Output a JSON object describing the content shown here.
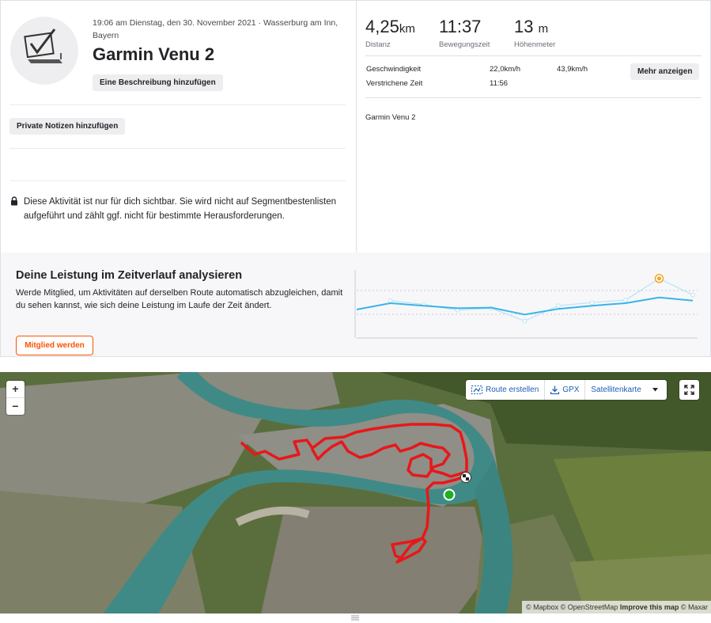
{
  "header": {
    "meta": "19:06 am Dienstag, den 30. November 2021 · Wasserburg am Inn, Bayern",
    "title": "Garmin Venu 2",
    "description_button": "Eine Beschreibung hinzufügen",
    "notes_button": "Private Notizen hinzufügen",
    "privacy_text": "Diese Aktivität ist nur für dich sichtbar. Sie wird nicht auf Segmentbestenlisten aufgeführt und zählt ggf. nicht für bestimmte Herausforderungen."
  },
  "stats": [
    {
      "value": "4,25",
      "unit": "km",
      "label": "Distanz"
    },
    {
      "value": "11:37",
      "unit": "",
      "label": "Bewegungszeit"
    },
    {
      "value": "13",
      "unit": "m",
      "label": "Höhenmeter"
    }
  ],
  "details": {
    "speed_label": "Geschwindigkeit",
    "speed_avg": "22,0km/h",
    "speed_max": "43,9km/h",
    "elapsed_label": "Verstrichene Zeit",
    "elapsed_value": "11:56",
    "more_button": "Mehr anzeigen",
    "device": "Garmin Venu 2"
  },
  "upsell": {
    "title": "Deine Leistung im Zeitverlauf analysieren",
    "text": "Werde Mitglied, um Aktivitäten auf derselben Route automatisch abzugleichen, damit du sehen kannst, wie sich deine Leistung im Laufe der Zeit ändert.",
    "button": "Mitglied werden"
  },
  "chart_data": {
    "type": "line",
    "title": "",
    "xlabel": "",
    "ylabel": "",
    "series": [
      {
        "values": [
          4,
          5,
          4.6,
          4.2,
          4.3,
          3.2,
          4.1,
          4.6,
          5,
          5.9,
          5.4
        ]
      },
      {
        "values": [
          null,
          5.4,
          4.8,
          3.9,
          4.2,
          2.2,
          4.6,
          5.1,
          5.5,
          8.9,
          6.3
        ]
      }
    ],
    "highlight_index": 9,
    "ylim": [
      0,
      10
    ],
    "colors": {
      "line": "#3ab4e6",
      "marker": "#b9e3f4",
      "highlight": "#f4a623",
      "grid": "#c9c9d4"
    }
  },
  "map": {
    "zoom_in": "+",
    "zoom_out": "−",
    "route_button": "Route erstellen",
    "gpx_button": "GPX",
    "layer_button": "Satellitenkarte",
    "attribution_mapbox": "© Mapbox",
    "attribution_osm": "© OpenStreetMap",
    "attribution_improve": "Improve this map",
    "attribution_maxar": "© Maxar",
    "route_color": "#e8171a",
    "start_color": "#1fae24"
  }
}
